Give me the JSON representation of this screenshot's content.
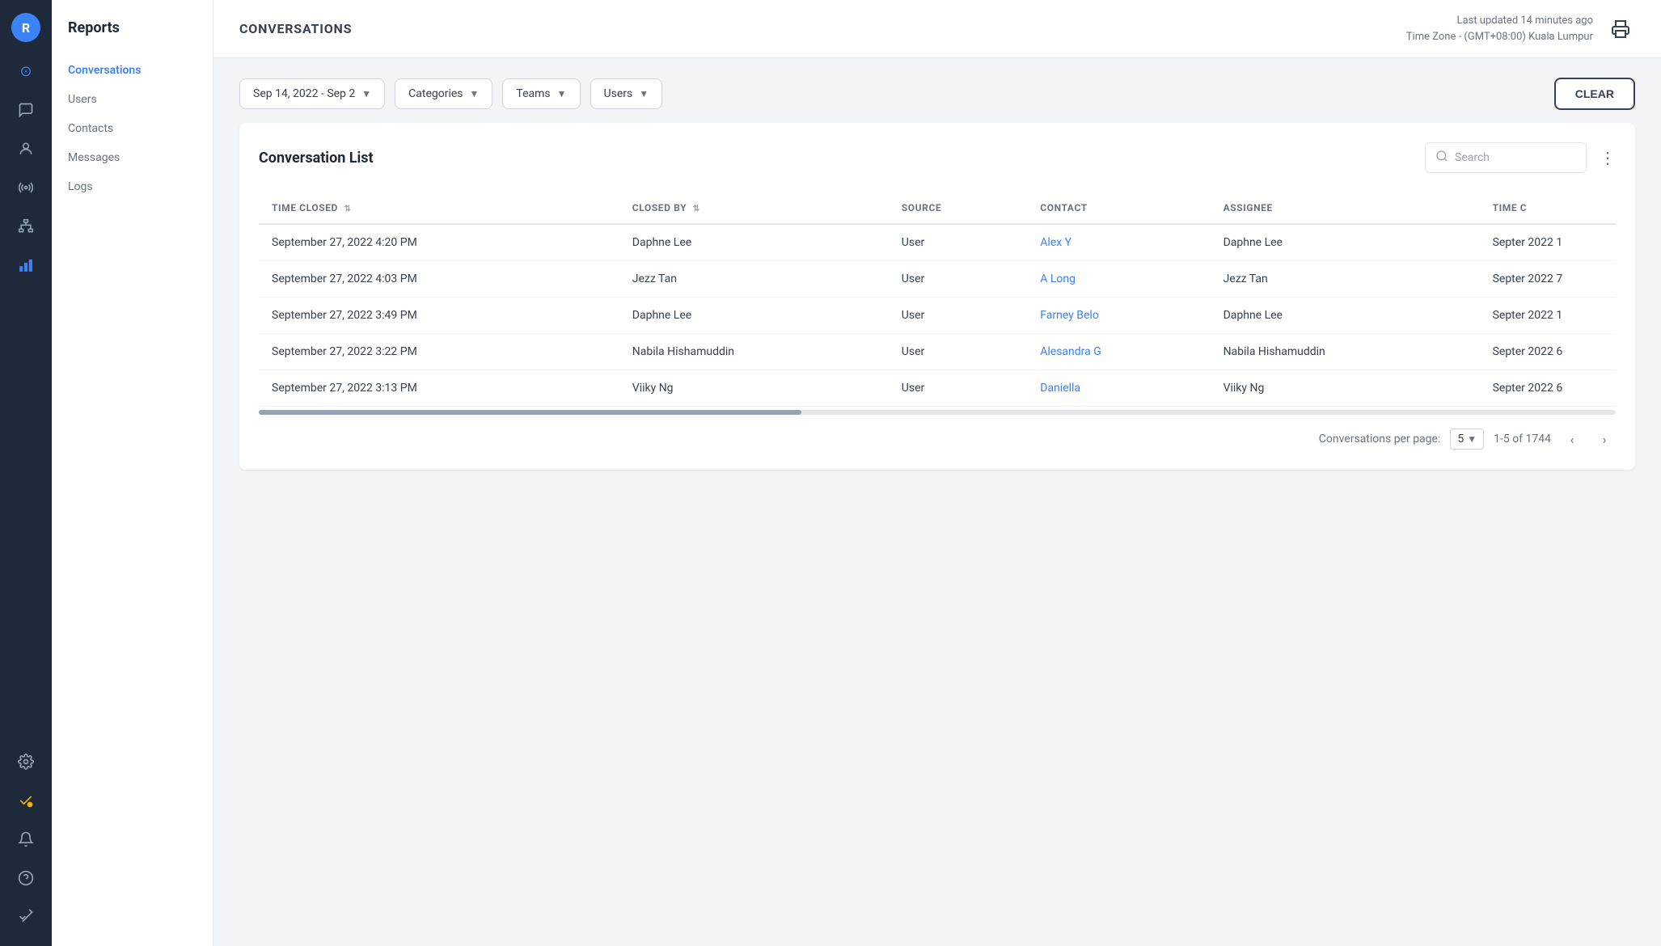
{
  "sidebar": {
    "avatar_letter": "R",
    "icons": [
      {
        "name": "dashboard-icon",
        "symbol": "⊙"
      },
      {
        "name": "chat-icon",
        "symbol": "💬"
      },
      {
        "name": "contacts-icon",
        "symbol": "👤"
      },
      {
        "name": "radio-icon",
        "symbol": "📡"
      },
      {
        "name": "hierarchy-icon",
        "symbol": "⊞"
      },
      {
        "name": "chart-icon",
        "symbol": "📊"
      },
      {
        "name": "settings-icon",
        "symbol": "⚙"
      },
      {
        "name": "badge-icon",
        "symbol": "✔"
      },
      {
        "name": "bell-icon",
        "symbol": "🔔"
      },
      {
        "name": "help-icon",
        "symbol": "?"
      },
      {
        "name": "check-icon",
        "symbol": "✔✔"
      }
    ]
  },
  "left_nav": {
    "title": "Reports",
    "items": [
      {
        "label": "Conversations",
        "active": true
      },
      {
        "label": "Users",
        "active": false
      },
      {
        "label": "Contacts",
        "active": false
      },
      {
        "label": "Messages",
        "active": false
      },
      {
        "label": "Logs",
        "active": false
      }
    ]
  },
  "header": {
    "title": "CONVERSATIONS",
    "meta_line1": "Last updated 14 minutes ago",
    "meta_line2": "Time Zone - (GMT+08:00) Kuala Lumpur",
    "print_icon": "🖨"
  },
  "filters": {
    "date_range": "Sep 14, 2022 - Sep 2",
    "categories_placeholder": "Categories",
    "teams_placeholder": "Teams",
    "users_placeholder": "Users",
    "clear_label": "CLEAR"
  },
  "conversation_list": {
    "title": "Conversation List",
    "search_placeholder": "Search",
    "columns": [
      {
        "label": "TIME CLOSED",
        "sortable": true
      },
      {
        "label": "CLOSED BY",
        "sortable": true
      },
      {
        "label": "SOURCE",
        "sortable": false
      },
      {
        "label": "CONTACT",
        "sortable": false
      },
      {
        "label": "ASSIGNEE",
        "sortable": false
      },
      {
        "label": "TIME C",
        "sortable": false
      }
    ],
    "rows": [
      {
        "time_closed": "September 27, 2022 4:20 PM",
        "closed_by": "Daphne Lee",
        "source": "User",
        "contact": "Alex Y",
        "assignee": "Daphne Lee",
        "time_c": "Septer 2022 1"
      },
      {
        "time_closed": "September 27, 2022 4:03 PM",
        "closed_by": "Jezz Tan",
        "source": "User",
        "contact": "A Long",
        "assignee": "Jezz Tan",
        "time_c": "Septer 2022 7"
      },
      {
        "time_closed": "September 27, 2022 3:49 PM",
        "closed_by": "Daphne Lee",
        "source": "User",
        "contact": "Farney Belo",
        "assignee": "Daphne Lee",
        "time_c": "Septer 2022 1"
      },
      {
        "time_closed": "September 27, 2022 3:22 PM",
        "closed_by": "Nabila Hishamuddin",
        "source": "User",
        "contact": "Alesandra G",
        "assignee": "Nabila Hishamuddin",
        "time_c": "Septer 2022 6"
      },
      {
        "time_closed": "September 27, 2022 3:13 PM",
        "closed_by": "Viiky Ng",
        "source": "User",
        "contact": "Daniella",
        "assignee": "Viiky Ng",
        "time_c": "Septer 2022 6"
      }
    ],
    "pagination": {
      "per_page_label": "Conversations per page:",
      "per_page_value": "5",
      "range_label": "1-5 of 1744"
    }
  }
}
